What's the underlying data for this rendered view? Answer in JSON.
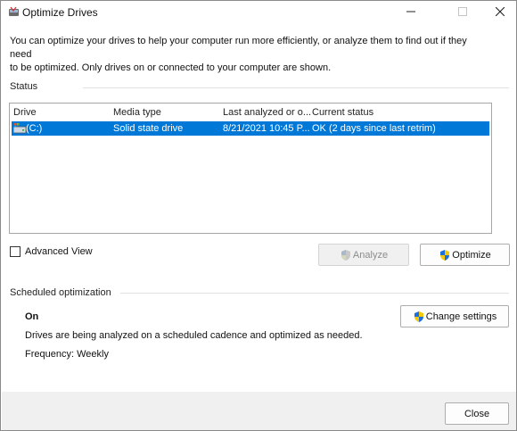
{
  "window": {
    "title": "Optimize Drives",
    "icons": {
      "app": "optimize-drives-icon",
      "minimize": "minimize-icon",
      "maximize": "maximize-icon",
      "close": "close-icon"
    }
  },
  "intro": {
    "line1": "You can optimize your drives to help your computer run more efficiently, or analyze them to find out if they need",
    "line2": "to be optimized. Only drives on or connected to your computer are shown."
  },
  "status": {
    "label": "Status",
    "columns": [
      "Drive",
      "Media type",
      "Last analyzed or o...",
      "Current status"
    ],
    "rows": [
      {
        "drive": "(C:)",
        "media_type": "Solid state drive",
        "last_analyzed": "8/21/2021 10:45 P...",
        "current_status": "OK (2 days since last retrim)",
        "selected": true
      }
    ],
    "selection_color": "#0078d7"
  },
  "advanced_view": {
    "label": "Advanced View",
    "checked": false
  },
  "buttons": {
    "analyze": "Analyze",
    "optimize": "Optimize",
    "change_settings": "Change settings",
    "close": "Close"
  },
  "scheduled": {
    "label": "Scheduled optimization",
    "state": "On",
    "description": "Drives are being analyzed on a scheduled cadence and optimized as needed.",
    "frequency": "Frequency: Weekly"
  }
}
